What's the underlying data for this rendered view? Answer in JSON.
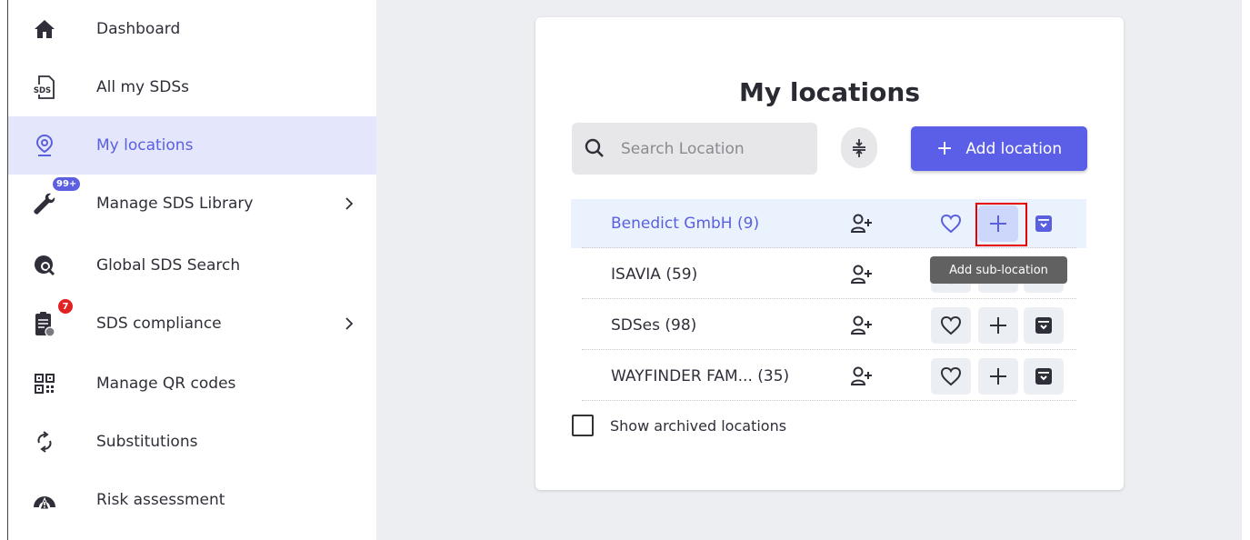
{
  "sidebar": {
    "items": [
      {
        "label": "Dashboard",
        "icon": "home-icon"
      },
      {
        "label": "All my SDSs",
        "icon": "sds-document-icon",
        "icon_text": "SDS"
      },
      {
        "label": "My locations",
        "icon": "location-pin-icon",
        "active": true
      },
      {
        "label": "Manage SDS Library",
        "icon": "wrench-icon",
        "badge": "99+",
        "has_submenu": true
      },
      {
        "label": "Global SDS Search",
        "icon": "global-search-icon"
      },
      {
        "label": "SDS compliance",
        "icon": "clipboard-check-icon",
        "badge": "7",
        "has_submenu": true
      },
      {
        "label": "Manage QR codes",
        "icon": "qr-code-icon"
      },
      {
        "label": "Substitutions",
        "icon": "swap-arrows-icon"
      },
      {
        "label": "Risk assessment",
        "icon": "risk-gauge-icon"
      }
    ]
  },
  "main": {
    "title": "My locations",
    "search": {
      "placeholder": "Search Location",
      "value": ""
    },
    "add_button": {
      "plus": "+",
      "label": "Add location"
    },
    "locations": [
      {
        "name": "Benedict GmbH (9)",
        "selected": true
      },
      {
        "name": "ISAVIA (59)",
        "selected": false
      },
      {
        "name": "SDSes (98)",
        "selected": false
      },
      {
        "name": "WAYFINDER FAM...  (35)",
        "selected": false
      }
    ],
    "tooltip": "Add sub-location",
    "show_archived": {
      "label": "Show archived locations",
      "checked": false
    }
  },
  "colors": {
    "accent": "#5b5fe8",
    "active_nav_bg": "#e4e6fb",
    "selected_row_bg": "#eaf2fd",
    "badge_red": "#e22222",
    "highlight_red": "#e60000",
    "background": "#eceef2"
  }
}
